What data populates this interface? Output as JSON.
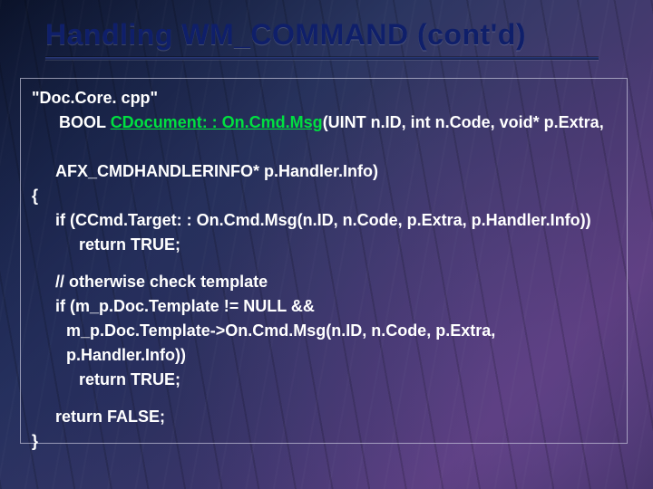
{
  "title": "Handling WM_COMMAND (cont'd)",
  "code": {
    "l1": "\"Doc.Core. cpp\"",
    "l2a": "BOOL ",
    "l2b": "CDocument: : On.Cmd.Msg",
    "l2c": "(UINT n.ID, int n.Code, void* p.Extra,",
    "l3": "AFX_CMDHANDLERINFO* p.Handler.Info)",
    "l4": "{",
    "l5": "if (CCmd.Target: : On.Cmd.Msg(n.ID, n.Code, p.Extra, p.Handler.Info))",
    "l6": "return TRUE;",
    "l7": "// otherwise check template",
    "l8": "if (m_p.Doc.Template != NULL &&",
    "l9": "m_p.Doc.Template->On.Cmd.Msg(n.ID, n.Code, p.Extra, p.Handler.Info))",
    "l10": "return TRUE;",
    "l11": "return FALSE;",
    "l12": "}"
  }
}
